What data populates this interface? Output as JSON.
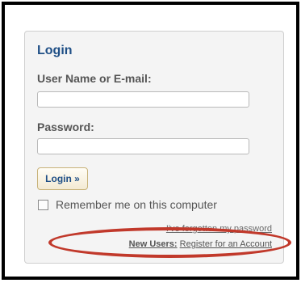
{
  "login": {
    "title": "Login",
    "username_label": "User Name or E-mail:",
    "username_value": "",
    "password_label": "Password:",
    "password_value": "",
    "login_button": "Login »",
    "remember_label": "Remember me on this computer",
    "remember_checked": false,
    "forgot_link": "I've forgotten my password",
    "register_prefix": "New Users:",
    "register_link": "Register for an Account"
  },
  "colors": {
    "title": "#1f4f86",
    "panel_background": "#f4f4f4",
    "highlight": "#c1392b"
  }
}
